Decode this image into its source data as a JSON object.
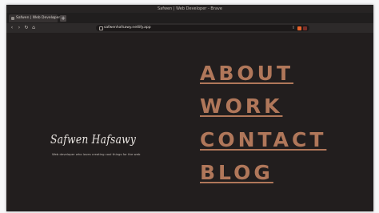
{
  "window": {
    "title": "Safwen | Web Developer - Brave"
  },
  "tabs": [
    {
      "label": "Safwen | Web Developer",
      "close": "×"
    }
  ],
  "new_tab_label": "+",
  "nav_buttons": {
    "back": "‹",
    "forward": "›",
    "reload": "↻",
    "bookmark": "⌂"
  },
  "address_bar": {
    "url": "safwenhafsawy.netlify.app",
    "share": "⇪"
  },
  "toolbar_right": [
    "▭",
    "≡"
  ],
  "hero": {
    "name": "Safwen Hafsawy",
    "tagline": "Web developer who loves creating cool things for the web"
  },
  "menu": {
    "items": [
      {
        "label": "ABOUT"
      },
      {
        "label": "WORK"
      },
      {
        "label": "CONTACT"
      },
      {
        "label": "BLOG"
      }
    ]
  },
  "colors": {
    "background": "#221e1e",
    "accent": "#b0775a",
    "text": "#e9e5e1"
  },
  "icons": [
    "lock-icon",
    "share-icon",
    "brave-lion-icon",
    "brave-rewards-icon",
    "sidebar-icon",
    "menu-icon"
  ]
}
